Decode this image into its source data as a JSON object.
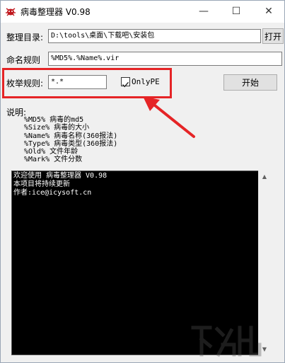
{
  "window": {
    "title": "病毒整理器 V0.98",
    "controls": {
      "minimize": "—",
      "maximize": "☐",
      "close": "✕"
    }
  },
  "form": {
    "dir_label": "整理目录:",
    "dir_value": "D:\\tools\\桌面\\下载吧\\安装包",
    "open_button": "打开",
    "naming_label": "命名规则",
    "naming_value": "%MD5%.%Name%.vir",
    "enum_label": "枚举规则:",
    "enum_value": "*.*",
    "onlype_label": "OnlyPE",
    "onlype_checked": true,
    "start_button": "开始"
  },
  "description": {
    "heading": "说明:",
    "lines": [
      "%MD5%  病毒的md5",
      "%Size% 病毒的大小",
      "%Name% 病毒名称(360报法)",
      "%Type% 病毒类型(360报法)",
      "%Old%  文件年龄",
      "%Mark% 文件分数"
    ]
  },
  "console": {
    "lines": [
      "欢迎使用 病毒整理器 V0.98",
      "本项目将持续更新",
      "作者:ice@icysoft.cn"
    ]
  },
  "colors": {
    "highlight": "#e52426",
    "console_bg": "#000000",
    "console_fg": "#ffffff"
  }
}
